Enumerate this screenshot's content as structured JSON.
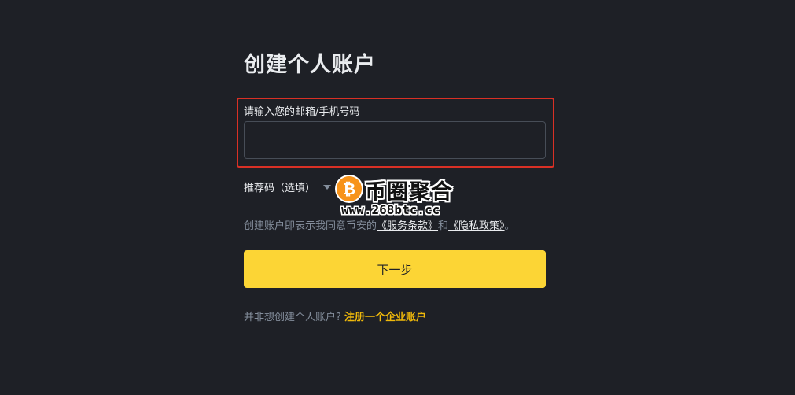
{
  "page": {
    "title": "创建个人账户"
  },
  "form": {
    "email_label": "请输入您的邮箱/手机号码",
    "email_value": "",
    "referral_label": "推荐码（选填）"
  },
  "terms": {
    "prefix": "创建账户即表示我同意币安的",
    "service_link": "《服务条款》",
    "and": "和",
    "privacy_link": "《隐私政策》",
    "suffix": "。"
  },
  "actions": {
    "next_label": "下一步"
  },
  "footer": {
    "question": "并非想创建个人账户?",
    "enterprise_link": "注册一个企业账户"
  },
  "watermark": {
    "title": "币圈聚合",
    "url": "www.268btc.cc",
    "coin_glyph": "₿"
  },
  "colors": {
    "background": "#1e2026",
    "accent_yellow": "#fcd535",
    "link_yellow": "#f0b90b",
    "highlight_red": "#d93025",
    "muted_text": "#848e9c"
  }
}
